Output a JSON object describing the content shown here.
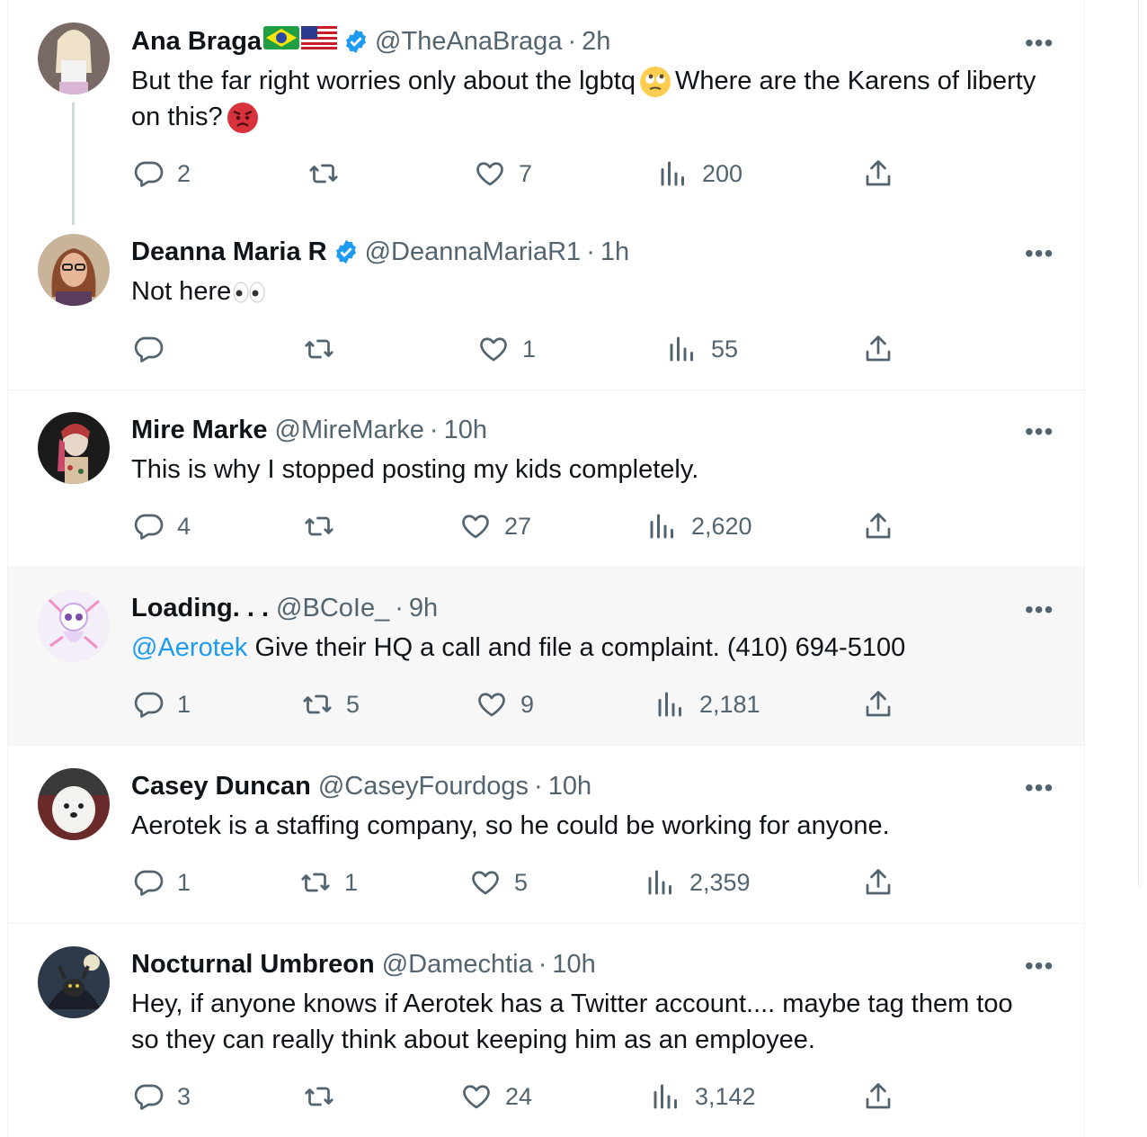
{
  "tweets": [
    {
      "name": "Ana Braga",
      "handle": "@TheAnaBraga",
      "sep": "·",
      "time": "2h",
      "flags": [
        "🇧🇷",
        "🇺🇸"
      ],
      "text_a": "But the far right worries only about the lgbtq",
      "text_b": "Where are the Karens of liberty on this?",
      "emoji_1": "face-with-rolling-eyes",
      "emoji_2": "angry-face",
      "replies": "2",
      "retweets": "",
      "likes": "7",
      "views": "200"
    },
    {
      "name": "Deanna Maria R",
      "handle": "@DeannaMariaR1",
      "sep": "·",
      "time": "1h",
      "text_a": "Not here",
      "emoji_1": "eyes",
      "replies": "",
      "retweets": "",
      "likes": "1",
      "views": "55"
    },
    {
      "name": "Mire Marke",
      "handle": "@MireMarke",
      "sep": "·",
      "time": "10h",
      "text_a": "This is why I stopped posting my kids completely.",
      "replies": "4",
      "retweets": "",
      "likes": "27",
      "views": "2,620"
    },
    {
      "name": "Loading. . .",
      "handle": "@BCoIe_",
      "sep": "·",
      "time": "9h",
      "mention": "@Aerotek",
      "text_a": " Give their HQ a call and file a complaint. (410) 694-5100",
      "replies": "1",
      "retweets": "5",
      "likes": "9",
      "views": "2,181"
    },
    {
      "name": "Casey Duncan",
      "handle": "@CaseyFourdogs",
      "sep": "·",
      "time": "10h",
      "text_a": "Aerotek is a staffing company, so he could be working for anyone.",
      "replies": "1",
      "retweets": "1",
      "likes": "5",
      "views": "2,359"
    },
    {
      "name": "Nocturnal Umbreon",
      "handle": "@Damechtia",
      "sep": "·",
      "time": "10h",
      "text_a": "Hey, if anyone knows if Aerotek has a Twitter account.... maybe tag them too so they can really think about keeping him as an employee.",
      "replies": "3",
      "retweets": "",
      "likes": "24",
      "views": "3,142"
    }
  ],
  "more_label": "•••",
  "colors": {
    "verified": "#1d9bf0",
    "mention": "#1d9bf0",
    "muted": "#536471",
    "hover_bg": "#f7f7f7"
  },
  "icons": [
    "reply-icon",
    "retweet-icon",
    "like-icon",
    "views-icon",
    "share-icon",
    "verified-badge-icon",
    "more-icon"
  ]
}
